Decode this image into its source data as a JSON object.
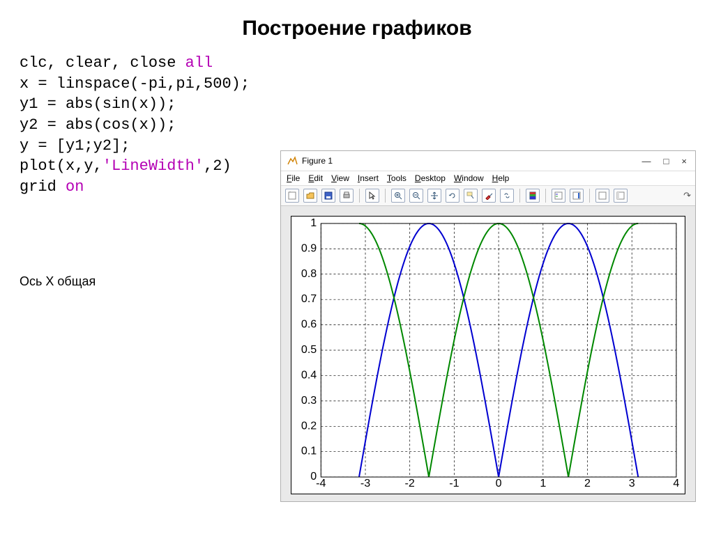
{
  "title": "Построение графиков",
  "code_lines": [
    {
      "plain": "clc, clear, close ",
      "kw": "all"
    },
    {
      "plain": "x = linspace(-pi,pi,500);"
    },
    {
      "plain": "y1 = abs(sin(x));"
    },
    {
      "plain": "y2 = abs(cos(x));"
    },
    {
      "plain": "y = [y1;y2];"
    },
    {
      "plain": "plot(x,y,",
      "str": "'LineWidth'",
      "tail": ",2)"
    },
    {
      "plain": "grid ",
      "kw": "on"
    }
  ],
  "note": "Ось X общая",
  "figure": {
    "title": "Figure 1",
    "winbtns": {
      "min": "—",
      "max": "□",
      "close": "×"
    },
    "menu": [
      "File",
      "Edit",
      "View",
      "Insert",
      "Tools",
      "Desktop",
      "Window",
      "Help"
    ],
    "restore_icon": "↷"
  },
  "chart_data": {
    "type": "line",
    "xlabel": "",
    "ylabel": "",
    "title": "",
    "xlim": [
      -4,
      4
    ],
    "ylim": [
      0,
      1
    ],
    "xticks": [
      -4,
      -3,
      -2,
      -1,
      0,
      1,
      2,
      3,
      4
    ],
    "yticks": [
      0,
      0.1,
      0.2,
      0.3,
      0.4,
      0.5,
      0.6,
      0.7,
      0.8,
      0.9,
      1
    ],
    "grid": true,
    "series": [
      {
        "name": "abs(sin(x))",
        "color": "#0000d0",
        "fn": "abs_sin",
        "domain": [
          -3.14159265,
          3.14159265
        ],
        "n": 200
      },
      {
        "name": "abs(cos(x))",
        "color": "#008800",
        "fn": "abs_cos",
        "domain": [
          -3.14159265,
          3.14159265
        ],
        "n": 200
      }
    ]
  }
}
